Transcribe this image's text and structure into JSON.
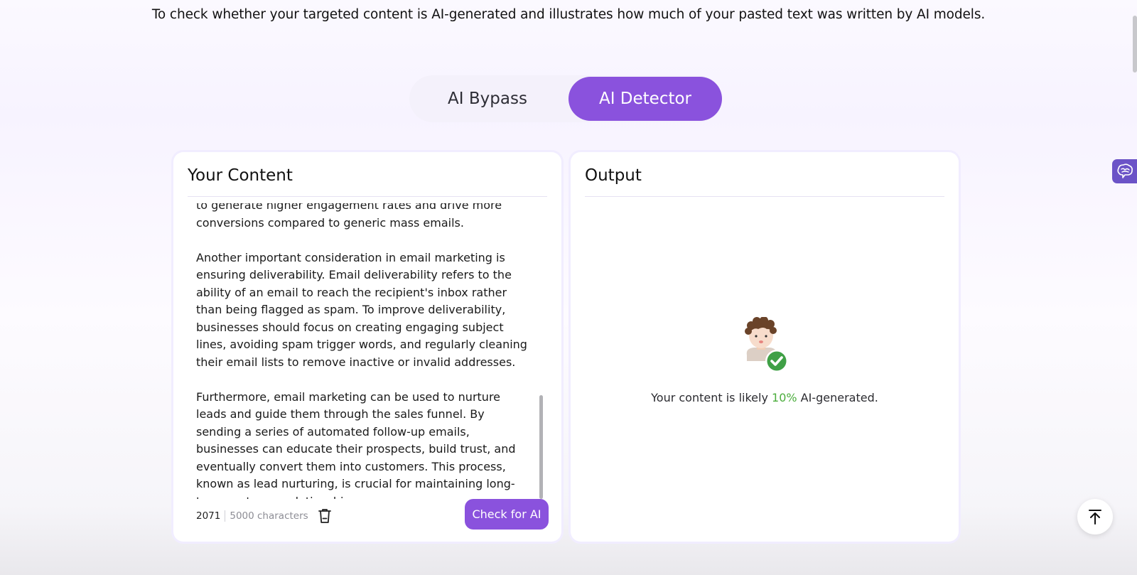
{
  "header": {
    "subtitle": "To check whether your targeted content is AI-generated and illustrates how much of your pasted text was written by AI models."
  },
  "tabs": [
    {
      "label": "AI Bypass",
      "active": false
    },
    {
      "label": "AI Detector",
      "active": true
    }
  ],
  "input_panel": {
    "title": "Your Content",
    "paragraphs": [
      "to generate higher engagement rates and drive more conversions compared to generic mass emails.",
      "Another important consideration in email marketing is ensuring deliverability. Email deliverability refers to the ability of an email to reach the recipient's inbox rather than being flagged as spam. To improve deliverability, businesses should focus on creating engaging subject lines, avoiding spam trigger words, and regularly cleaning their email lists to remove inactive or invalid addresses.",
      "Furthermore, email marketing can be used to nurture leads and guide them through the sales funnel. By sending a series of automated follow-up emails, businesses can educate their prospects, build trust, and eventually convert them into customers. This process, known as lead nurturing, is crucial for maintaining long-term customer relationships."
    ],
    "char_count": "2071",
    "char_limit": "5000 characters",
    "check_button": "Check for AI"
  },
  "output_panel": {
    "title": "Output",
    "result_prefix": "Your content is likely ",
    "result_percent": "10%",
    "result_suffix": " AI-generated."
  },
  "colors": {
    "accent": "#8a52dd",
    "percent_green": "#4bad3c",
    "side_widget": "#6b53c7"
  },
  "icons": {
    "trash": "trash-icon",
    "avatar": "avatar-check-icon",
    "side_widget": "brain-icon",
    "to_top": "arrow-to-top-icon"
  }
}
